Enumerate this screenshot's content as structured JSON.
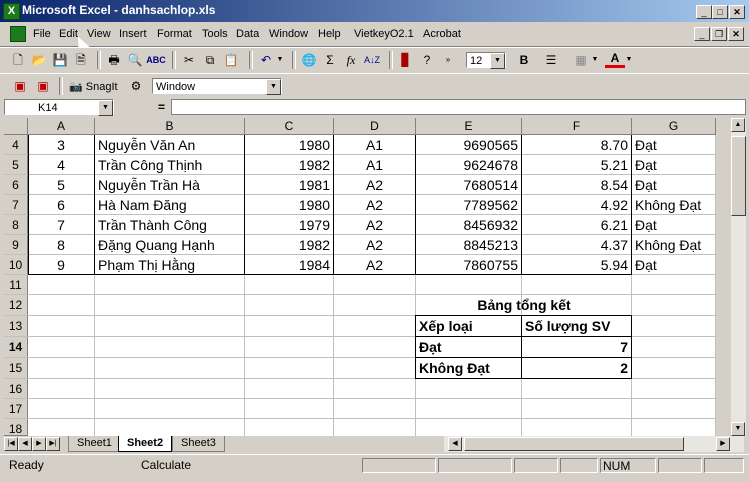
{
  "window": {
    "title": "Microsoft Excel - danhsachlop.xls",
    "app_icon_letter": "X"
  },
  "menu": [
    {
      "label": "File"
    },
    {
      "label": "Edit"
    },
    {
      "label": "View"
    },
    {
      "label": "Insert"
    },
    {
      "label": "Format"
    },
    {
      "label": "Tools"
    },
    {
      "label": "Data"
    },
    {
      "label": "Window"
    },
    {
      "label": "Help"
    },
    {
      "label": "VietkeyO2.1"
    },
    {
      "label": "Acrobat"
    }
  ],
  "toolbar": {
    "font_size": "12",
    "snagit_label": "SnagIt",
    "snagit_window": "Window"
  },
  "formula_bar": {
    "name_box": "K14",
    "equals": "=",
    "formula": ""
  },
  "columns": [
    "A",
    "B",
    "C",
    "D",
    "E",
    "F",
    "G"
  ],
  "rows": [
    {
      "num": "4",
      "a": "3",
      "b": "Nguyễn Văn An",
      "c": "1980",
      "d": "A1",
      "e": "9690565",
      "f": "8.70",
      "g": "Đạt"
    },
    {
      "num": "5",
      "a": "4",
      "b": "Trần Công Thịnh",
      "c": "1982",
      "d": "A1",
      "e": "9624678",
      "f": "5.21",
      "g": "Đạt"
    },
    {
      "num": "6",
      "a": "5",
      "b": "Nguyễn Trần Hà",
      "c": "1981",
      "d": "A2",
      "e": "7680514",
      "f": "8.54",
      "g": "Đạt"
    },
    {
      "num": "7",
      "a": "6",
      "b": "Hà Nam Đăng",
      "c": "1980",
      "d": "A2",
      "e": "7789562",
      "f": "4.92",
      "g": "Không Đạt"
    },
    {
      "num": "8",
      "a": "7",
      "b": "Trần Thành Công",
      "c": "1979",
      "d": "A2",
      "e": "8456932",
      "f": "6.21",
      "g": "Đạt"
    },
    {
      "num": "9",
      "a": "8",
      "b": "Đặng Quang Hạnh",
      "c": "1982",
      "d": "A2",
      "e": "8845213",
      "f": "4.37",
      "g": "Không Đạt"
    },
    {
      "num": "10",
      "a": "9",
      "b": "Phạm Thị Hằng",
      "c": "1984",
      "d": "A2",
      "e": "7860755",
      "f": "5.94",
      "g": "Đạt"
    }
  ],
  "empty_rows": [
    "11",
    "12",
    "13",
    "14",
    "15",
    "16",
    "17",
    "18"
  ],
  "summary": {
    "title": "Bảng tổng kết",
    "header_type": "Xếp loại",
    "header_count": "Số lượng SV",
    "items": [
      {
        "type": "Đạt",
        "count": "7"
      },
      {
        "type": "Không Đạt",
        "count": "2"
      }
    ]
  },
  "sheets": [
    {
      "label": "Sheet1"
    },
    {
      "label": "Sheet2"
    },
    {
      "label": "Sheet3"
    }
  ],
  "active_sheet": "Sheet2",
  "status": {
    "mode": "Ready",
    "calc": "Calculate",
    "num": "NUM"
  }
}
